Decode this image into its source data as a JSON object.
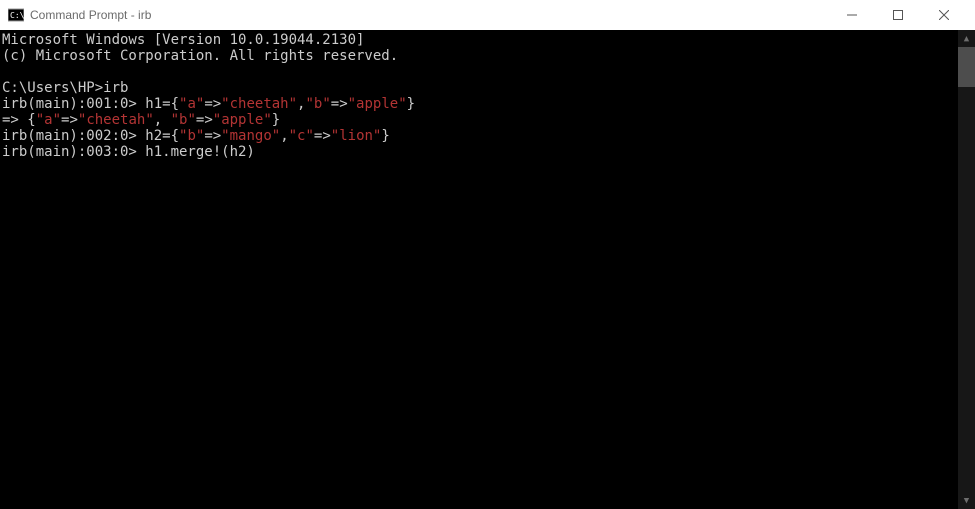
{
  "title": "Command Prompt - irb",
  "lines": {
    "ms1": "Microsoft Windows [Version 10.0.19044.2130]",
    "ms2": "(c) Microsoft Corporation. All rights reserved.",
    "path": "C:\\Users\\HP>",
    "cmd0": "irb",
    "p1": "irb(main):001:0>",
    "p2": "irb(main):002:0>",
    "p3": "irb(main):003:0>",
    "h1eq": " h1={",
    "h2eq": " h2={",
    "arrow": "=>",
    "arrowSp": "=> ",
    "qa": "\"a\"",
    "qb": "\"b\"",
    "qc": "\"c\"",
    "cheetah": "\"cheetah\"",
    "apple": "\"apple\"",
    "mango": "\"mango\"",
    "lion": "\"lion\"",
    "brOpen": "{",
    "brClose": "}",
    "comma": ",",
    "commaSp": ", ",
    "merge": " h1.merge!(h2)"
  }
}
